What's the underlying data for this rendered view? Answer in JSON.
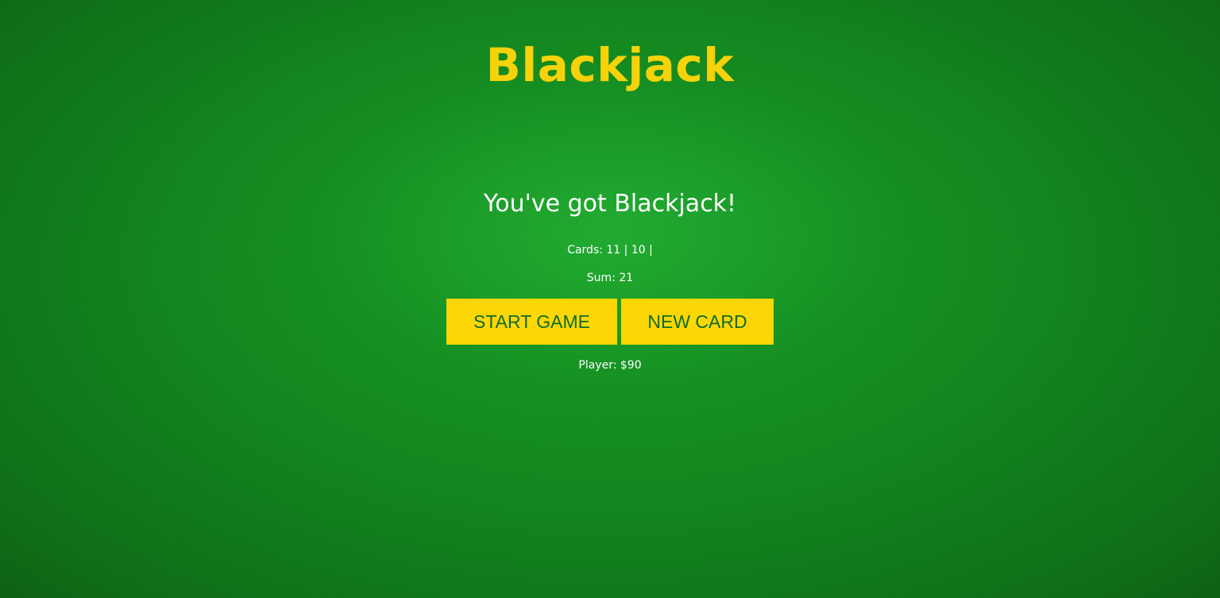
{
  "game": {
    "title": "Blackjack",
    "message": "You've got Blackjack!",
    "cards_label": "Cards:",
    "cards": [
      11,
      10
    ],
    "cards_text": "Cards: 11 | 10 |",
    "sum_text": "Sum: 21",
    "sum": 21,
    "player_text": "Player: $90"
  },
  "buttons": {
    "start_label": "START GAME",
    "new_card_label": "NEW CARD"
  },
  "colors": {
    "felt": "#0a8418",
    "title": "#f5d20a",
    "button_bg": "#fcd705",
    "button_text": "#0e6b2b",
    "text": "#ffffff"
  }
}
